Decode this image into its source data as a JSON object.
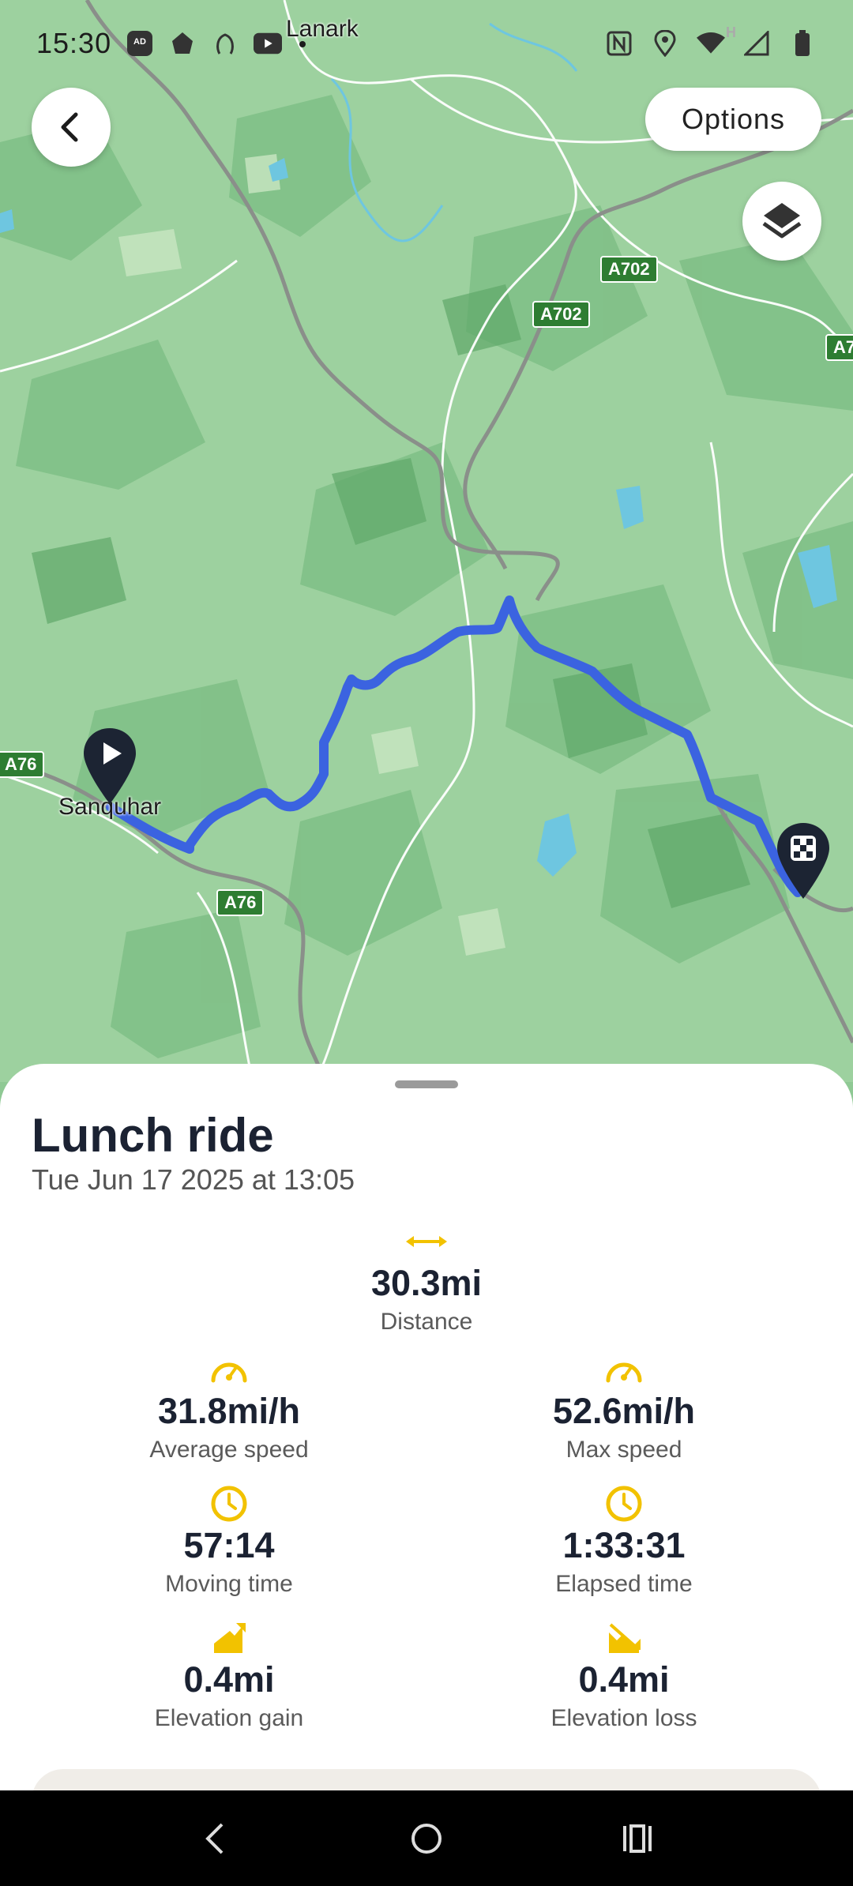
{
  "status_bar": {
    "time": "15:30",
    "left_icons": [
      "adblock-icon",
      "bank-icon",
      "fingerprint-icon",
      "youtube-icon"
    ],
    "right_icons": [
      "nfc-icon",
      "location-icon",
      "wifi-icon",
      "signal-icon",
      "battery-icon"
    ],
    "network_label": "H"
  },
  "map": {
    "place_labels": {
      "lanark": "Lanark",
      "sanquhar": "Sanquhar"
    },
    "road_labels": {
      "a702_1": "A702",
      "a702_2": "A702",
      "a7_edge": "A7",
      "a76_left": "A76",
      "a76_bottom": "A76"
    },
    "route_color": "#3b63e0",
    "start_marker": "start-flag-icon",
    "end_marker": "finish-flag-icon"
  },
  "toolbar": {
    "options_label": "Options"
  },
  "activity": {
    "title": "Lunch ride",
    "date": "Tue Jun 17 2025 at 13:05"
  },
  "stats": {
    "distance": {
      "value": "30.3mi",
      "label": "Distance",
      "icon": "distance-icon"
    },
    "average_speed": {
      "value": "31.8mi/h",
      "label": "Average speed",
      "icon": "speedometer-icon"
    },
    "max_speed": {
      "value": "52.6mi/h",
      "label": "Max speed",
      "icon": "speedometer-icon"
    },
    "moving_time": {
      "value": "57:14",
      "label": "Moving time",
      "icon": "clock-icon"
    },
    "elapsed_time": {
      "value": "1:33:31",
      "label": "Elapsed time",
      "icon": "clock-icon"
    },
    "elevation_gain": {
      "value": "0.4mi",
      "label": "Elevation gain",
      "icon": "elevation-gain-icon"
    },
    "elevation_loss": {
      "value": "0.4mi",
      "label": "Elevation loss",
      "icon": "elevation-loss-icon"
    }
  },
  "colors": {
    "accent": "#f2c200",
    "route": "#3b63e0",
    "text_dark": "#1b2232"
  }
}
